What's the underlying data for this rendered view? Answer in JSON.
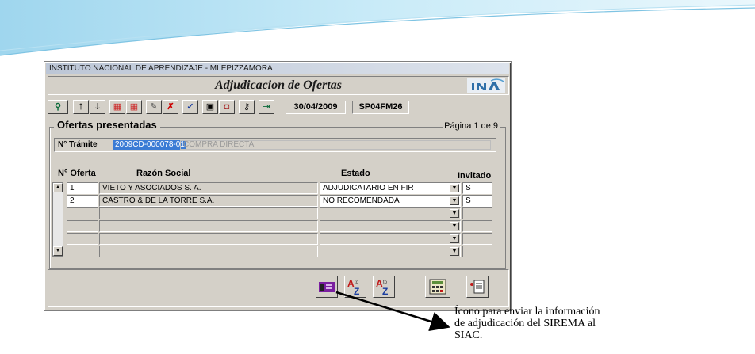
{
  "window": {
    "title": "INSTITUTO NACIONAL DE APRENDIZAJE - MLEPIZZAMORA",
    "form_title": "Adjudicacion de Ofertas"
  },
  "toolbar": {
    "date": "30/04/2009",
    "code": "SP04FM26"
  },
  "group": {
    "title": "Ofertas presentadas",
    "page_info": "Página 1 de 9"
  },
  "tramite": {
    "label": "N° Trámite",
    "value": "2009CD-000078-01",
    "description": "COMPRA DIRECTA"
  },
  "table": {
    "headers": {
      "oferta": "N° Oferta",
      "razon": "Razón Social",
      "estado": "Estado",
      "invitado": "Invitado"
    },
    "rows": [
      {
        "oferta": "1",
        "razon": "VIETO Y ASOCIADOS S. A.",
        "estado": "ADJUDICATARIO EN FIR",
        "invitado": "S"
      },
      {
        "oferta": "2",
        "razon": "CASTRO & DE LA TORRE S.A.",
        "estado": "NO RECOMENDADA",
        "invitado": "S"
      },
      {
        "oferta": "",
        "razon": "",
        "estado": "",
        "invitado": ""
      },
      {
        "oferta": "",
        "razon": "",
        "estado": "",
        "invitado": ""
      },
      {
        "oferta": "",
        "razon": "",
        "estado": "",
        "invitado": ""
      },
      {
        "oferta": "",
        "razon": "",
        "estado": "",
        "invitado": ""
      }
    ]
  },
  "bottom_buttons": {
    "sort_label": "A to Z"
  },
  "annotation": {
    "line1": "Ícono para enviar la información",
    "line2": "de adjudicación del SIREMA al",
    "line3": "SIAC."
  },
  "colors": {
    "accent": "#3a7bd5",
    "window_bg": "#d4d0c8",
    "send_icon": "#7a1fa0"
  }
}
